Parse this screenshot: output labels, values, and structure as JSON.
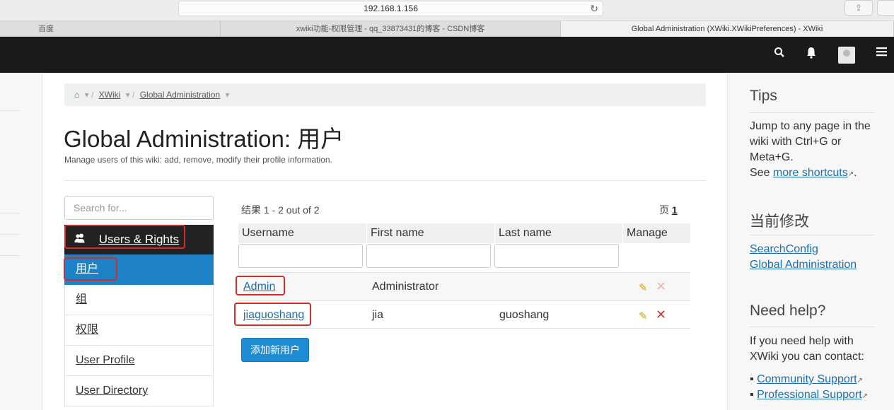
{
  "browser": {
    "address": "192.168.1.156",
    "tabs": [
      "百度",
      "xwiki功能-权限管理 - qq_33873431的博客 - CSDN博客",
      "Global Administration (XWiki.XWikiPreferences) - XWiki"
    ],
    "share_icon": "⇪"
  },
  "topbar": {
    "search_icon": "search-icon",
    "bell_icon": "bell-icon",
    "menu_icon": "hamburger-icon"
  },
  "breadcrumb": {
    "items": [
      "XWiki",
      "Global Administration"
    ]
  },
  "page": {
    "title": "Global Administration: 用户",
    "description": "Manage users of this wiki: add, remove, modify their profile information."
  },
  "admin_menu": {
    "search_placeholder": "Search for...",
    "header": "Users & Rights",
    "items": [
      "用户",
      "组",
      "权限",
      "User Profile",
      "User Directory"
    ]
  },
  "results": {
    "count_text": "结果 1 - 2 out of 2",
    "page_label": "页",
    "page_number": "1",
    "columns": [
      "Username",
      "First name",
      "Last name",
      "Manage"
    ],
    "rows": [
      {
        "username": "Admin",
        "first": "Administrator",
        "last": ""
      },
      {
        "username": "jiaguoshang",
        "first": "jia",
        "last": "guoshang"
      }
    ],
    "add_button": "添加新用户"
  },
  "sidebar": {
    "tips_title": "Tips",
    "tips_text": "Jump to any page in the wiki with Ctrl+G or Meta+G.",
    "tips_see": "See",
    "tips_link": "more shortcuts",
    "recent_title": "当前修改",
    "recent_links": [
      "SearchConfig",
      "Global Administration"
    ],
    "help_title": "Need help?",
    "help_text": "If you need help with XWiki you can contact:",
    "help_links": [
      "Community Support",
      "Professional Support"
    ]
  },
  "colors": {
    "topbar": "#1a1a1a",
    "active_menu": "#1e82c6",
    "highlight_box": "#d92a2a",
    "link": "#1e6fa8"
  }
}
